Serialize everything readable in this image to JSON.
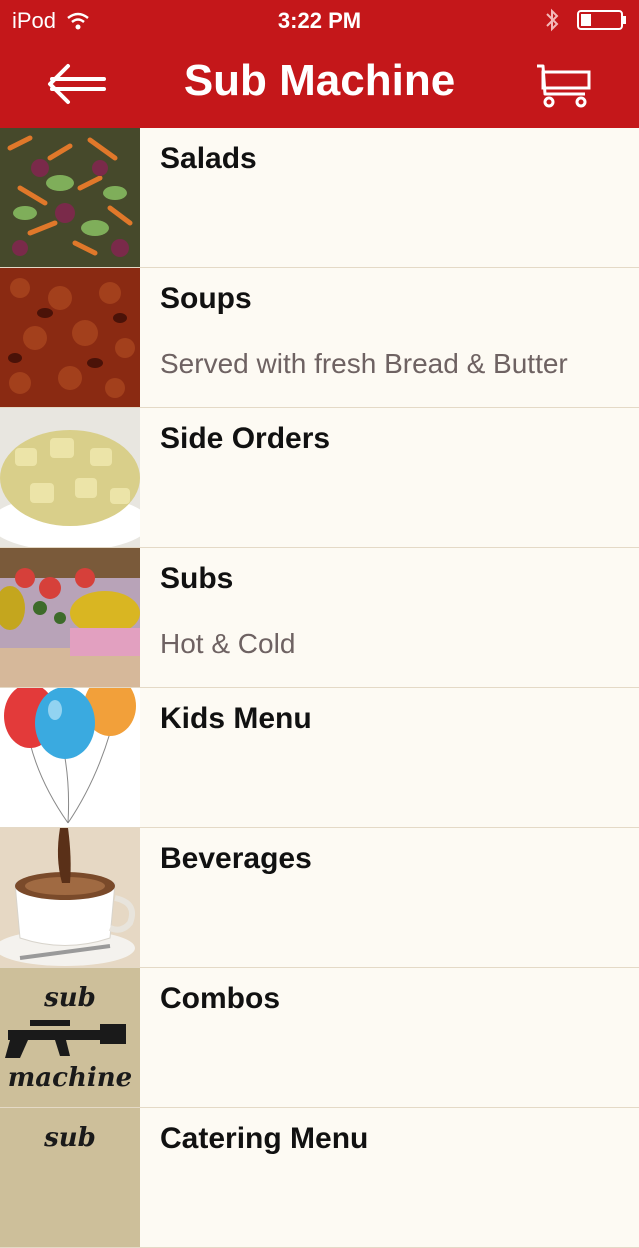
{
  "status": {
    "carrier": "iPod",
    "time": "3:22 PM"
  },
  "nav": {
    "title": "Sub Machine"
  },
  "menu": [
    {
      "label": "Salads",
      "subtitle": "",
      "thumb": "salad"
    },
    {
      "label": "Soups",
      "subtitle": "Served with fresh Bread & Butter",
      "thumb": "chili"
    },
    {
      "label": "Side Orders",
      "subtitle": "",
      "thumb": "potato-salad"
    },
    {
      "label": "Subs",
      "subtitle": "Hot & Cold",
      "thumb": "sub-sandwich"
    },
    {
      "label": "Kids Menu",
      "subtitle": "",
      "thumb": "balloons"
    },
    {
      "label": "Beverages",
      "subtitle": "",
      "thumb": "hot-cocoa"
    },
    {
      "label": "Combos",
      "subtitle": "",
      "thumb": "sub-machine-logo"
    },
    {
      "label": "Catering Menu",
      "subtitle": "",
      "thumb": "sub-machine-logo"
    }
  ],
  "logo": {
    "line1": "sub",
    "line2": "machine"
  },
  "colors": {
    "header": "#c4171a",
    "background": "#fdfaf3",
    "subtitle": "#6e6262"
  }
}
